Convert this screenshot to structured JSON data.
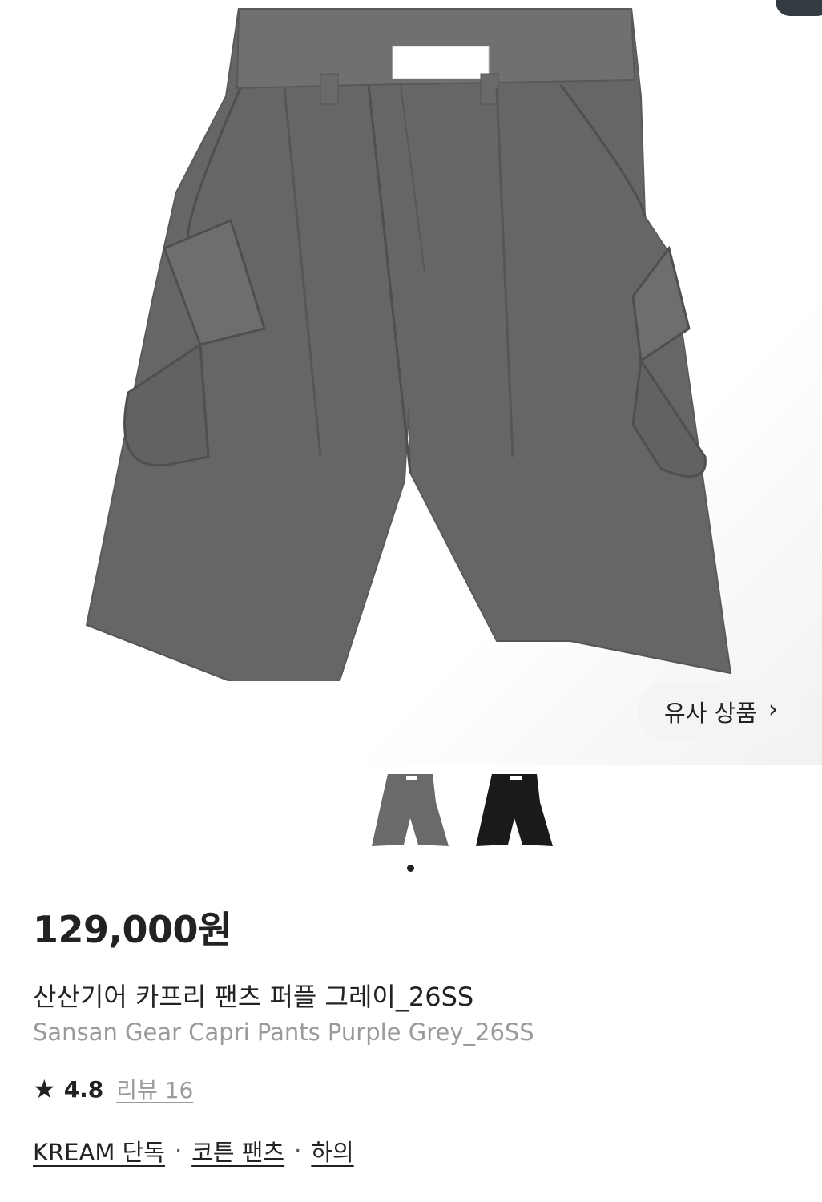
{
  "gallery": {
    "similar_products_label": "유사 상품",
    "thumbnails": [
      {
        "name": "grey",
        "color": "#6a6a6a"
      },
      {
        "name": "black",
        "color": "#1a1a1a"
      }
    ],
    "active_index": 0
  },
  "product": {
    "price": "129,000원",
    "name_ko": "산산기어 카프리 팬츠 퍼플 그레이_26SS",
    "name_en": "Sansan Gear Capri Pants Purple Grey_26SS",
    "rating": "4.8",
    "reviews_label": "리뷰 16",
    "tags": [
      "KREAM 단독",
      "코튼 팬츠",
      "하의"
    ],
    "separator": "·"
  }
}
